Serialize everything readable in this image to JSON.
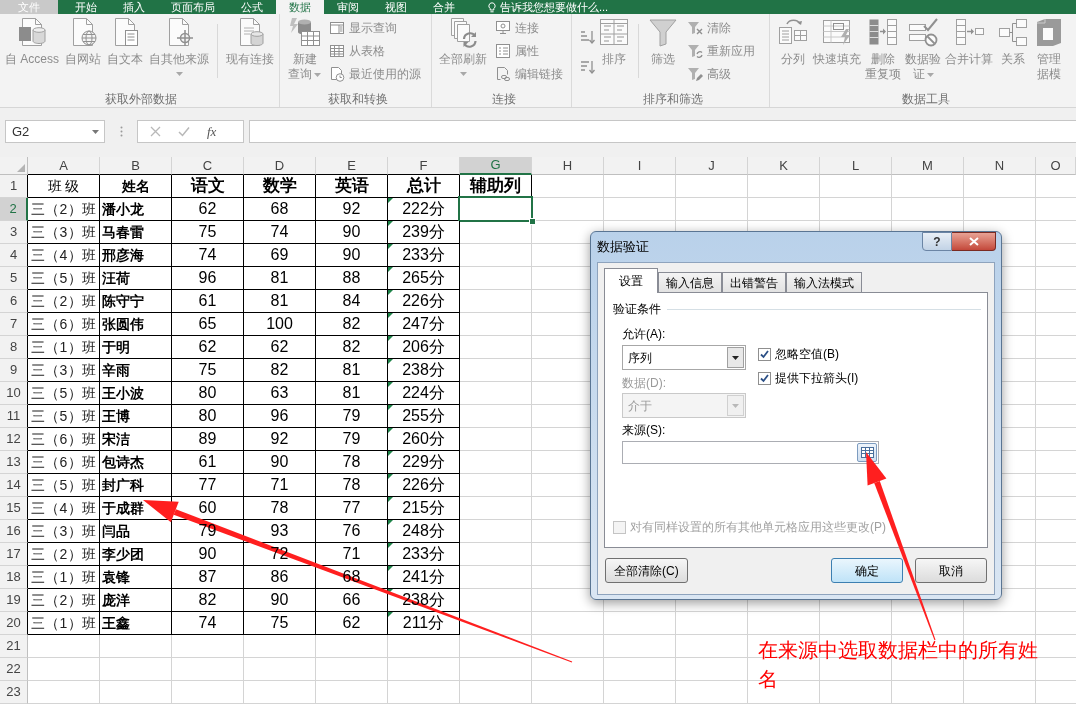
{
  "ribbon": {
    "tabs": [
      {
        "label": "文件",
        "kind": "file",
        "selected": false
      },
      {
        "label": "开始",
        "kind": "tab",
        "selected": false
      },
      {
        "label": "插入",
        "kind": "tab",
        "selected": false
      },
      {
        "label": "页面布局",
        "kind": "tab",
        "selected": false
      },
      {
        "label": "公式",
        "kind": "tab",
        "selected": false
      },
      {
        "label": "数据",
        "kind": "tab",
        "selected": true
      },
      {
        "label": "审阅",
        "kind": "tab",
        "selected": false
      },
      {
        "label": "视图",
        "kind": "tab",
        "selected": false
      },
      {
        "label": "合并",
        "kind": "tab",
        "selected": false
      }
    ],
    "tell_me": {
      "placeholder": "告诉我您想要做什么..."
    },
    "groups": [
      {
        "label": "获取外部数据",
        "items": [
          {
            "kind": "large",
            "lines": [
              "自 Access"
            ],
            "dropdown": false
          },
          {
            "kind": "large",
            "lines": [
              "自网站"
            ],
            "dropdown": false
          },
          {
            "kind": "large",
            "lines": [
              "自文本"
            ],
            "dropdown": false
          },
          {
            "kind": "large",
            "lines": [
              "自其他来源"
            ],
            "dropdown": true
          },
          {
            "kind": "separator"
          },
          {
            "kind": "large",
            "lines": [
              "现有连接"
            ],
            "dropdown": false
          }
        ]
      },
      {
        "label": "获取和转换",
        "items": [
          {
            "kind": "large",
            "lines": [
              "新建",
              "查询"
            ],
            "dropdown": true
          },
          {
            "kind": "small",
            "label": "显示查询"
          },
          {
            "kind": "small",
            "label": "从表格"
          },
          {
            "kind": "small",
            "label": "最近使用的源"
          }
        ]
      },
      {
        "label": "连接",
        "items": [
          {
            "kind": "large",
            "lines": [
              "全部刷新"
            ],
            "dropdown": true
          },
          {
            "kind": "small",
            "label": "连接"
          },
          {
            "kind": "small",
            "label": "属性"
          },
          {
            "kind": "small",
            "label": "编辑链接"
          }
        ]
      },
      {
        "label": "排序和筛选",
        "items": [
          {
            "kind": "icon"
          },
          {
            "kind": "icon"
          },
          {
            "kind": "large",
            "lines": [
              "排序"
            ],
            "dropdown": false
          },
          {
            "kind": "separator"
          },
          {
            "kind": "large",
            "lines": [
              "筛选"
            ],
            "dropdown": false
          },
          {
            "kind": "small",
            "label": "清除"
          },
          {
            "kind": "small",
            "label": "重新应用"
          },
          {
            "kind": "small",
            "label": "高级"
          }
        ]
      },
      {
        "label": "数据工具",
        "items": [
          {
            "kind": "large",
            "lines": [
              "分列"
            ],
            "dropdown": false
          },
          {
            "kind": "large",
            "lines": [
              "快速填充"
            ],
            "dropdown": false
          },
          {
            "kind": "large",
            "lines": [
              "删除",
              "重复项"
            ],
            "dropdown": false
          },
          {
            "kind": "large",
            "lines": [
              "数据验",
              "证"
            ],
            "dropdown": true
          },
          {
            "kind": "large",
            "lines": [
              "合并计算"
            ],
            "dropdown": false
          },
          {
            "kind": "large",
            "lines": [
              "关系"
            ],
            "dropdown": false
          },
          {
            "kind": "large",
            "lines": [
              "管理",
              "据模"
            ],
            "dropdown": false
          }
        ]
      }
    ]
  },
  "formula_bar": {
    "name_box": "G2",
    "function_label": "fx"
  },
  "sheet": {
    "columns": [
      {
        "label": "A",
        "selected": false
      },
      {
        "label": "B",
        "selected": false
      },
      {
        "label": "C",
        "selected": false
      },
      {
        "label": "D",
        "selected": false
      },
      {
        "label": "E",
        "selected": false
      },
      {
        "label": "F",
        "selected": false
      },
      {
        "label": "G",
        "selected": true
      },
      {
        "label": "H",
        "selected": false
      },
      {
        "label": "I",
        "selected": false
      },
      {
        "label": "J",
        "selected": false
      },
      {
        "label": "K",
        "selected": false
      },
      {
        "label": "L",
        "selected": false
      },
      {
        "label": "M",
        "selected": false
      },
      {
        "label": "N",
        "selected": false
      },
      {
        "label": "O",
        "selected": false
      }
    ],
    "rows": [
      {
        "label": "1",
        "selected": false
      },
      {
        "label": "2",
        "selected": true
      },
      {
        "label": "3",
        "selected": false
      },
      {
        "label": "4",
        "selected": false
      },
      {
        "label": "5",
        "selected": false
      },
      {
        "label": "6",
        "selected": false
      },
      {
        "label": "7",
        "selected": false
      },
      {
        "label": "8",
        "selected": false
      },
      {
        "label": "9",
        "selected": false
      },
      {
        "label": "10",
        "selected": false
      },
      {
        "label": "11",
        "selected": false
      },
      {
        "label": "12",
        "selected": false
      },
      {
        "label": "13",
        "selected": false
      },
      {
        "label": "14",
        "selected": false
      },
      {
        "label": "15",
        "selected": false
      },
      {
        "label": "16",
        "selected": false
      },
      {
        "label": "17",
        "selected": false
      },
      {
        "label": "18",
        "selected": false
      },
      {
        "label": "19",
        "selected": false
      },
      {
        "label": "20",
        "selected": false
      },
      {
        "label": "21",
        "selected": false
      },
      {
        "label": "22",
        "selected": false
      },
      {
        "label": "23",
        "selected": false
      }
    ],
    "table": {
      "header": [
        "班 级",
        "姓名",
        "语文",
        "数学",
        "英语",
        "总计",
        "辅助列"
      ],
      "rows": [
        {
          "cells": [
            "三（2）班",
            "潘小龙",
            "62",
            "68",
            "92",
            "222分"
          ],
          "warning": true
        },
        {
          "cells": [
            "三（3）班",
            "马春雷",
            "75",
            "74",
            "90",
            "239分"
          ],
          "warning": true
        },
        {
          "cells": [
            "三（4）班",
            "邢彦海",
            "74",
            "69",
            "90",
            "233分"
          ],
          "warning": true
        },
        {
          "cells": [
            "三（5）班",
            "汪荷",
            "96",
            "81",
            "88",
            "265分"
          ],
          "warning": true
        },
        {
          "cells": [
            "三（2）班",
            "陈守宁",
            "61",
            "81",
            "84",
            "226分"
          ],
          "warning": true
        },
        {
          "cells": [
            "三（6）班",
            "张圆伟",
            "65",
            "100",
            "82",
            "247分"
          ],
          "warning": true
        },
        {
          "cells": [
            "三（1）班",
            "于明",
            "62",
            "62",
            "82",
            "206分"
          ],
          "warning": true
        },
        {
          "cells": [
            "三（3）班",
            "辛雨",
            "75",
            "82",
            "81",
            "238分"
          ],
          "warning": true
        },
        {
          "cells": [
            "三（5）班",
            "王小波",
            "80",
            "63",
            "81",
            "224分"
          ],
          "warning": true
        },
        {
          "cells": [
            "三（5）班",
            "王博",
            "80",
            "96",
            "79",
            "255分"
          ],
          "warning": true
        },
        {
          "cells": [
            "三（6）班",
            "宋洁",
            "89",
            "92",
            "79",
            "260分"
          ],
          "warning": true
        },
        {
          "cells": [
            "三（6）班",
            "包诗杰",
            "61",
            "90",
            "78",
            "229分"
          ],
          "warning": true
        },
        {
          "cells": [
            "三（5）班",
            "封广科",
            "77",
            "71",
            "78",
            "226分"
          ],
          "warning": true
        },
        {
          "cells": [
            "三（4）班",
            "于成群",
            "60",
            "78",
            "77",
            "215分"
          ],
          "warning": true
        },
        {
          "cells": [
            "三（3）班",
            "闫品",
            "79",
            "93",
            "76",
            "248分"
          ],
          "warning": true
        },
        {
          "cells": [
            "三（2）班",
            "李少团",
            "90",
            "72",
            "71",
            "233分"
          ],
          "warning": true
        },
        {
          "cells": [
            "三（1）班",
            "袁锋",
            "87",
            "86",
            "68",
            "241分"
          ],
          "warning": true
        },
        {
          "cells": [
            "三（2）班",
            "庞洋",
            "82",
            "90",
            "66",
            "238分"
          ],
          "warning": true
        },
        {
          "cells": [
            "三（1）班",
            "王鑫",
            "74",
            "75",
            "62",
            "211分"
          ],
          "warning": true
        }
      ]
    }
  },
  "dialog": {
    "title": "数据验证",
    "help_label": "?",
    "tabs": [
      {
        "label": "设置",
        "selected": true
      },
      {
        "label": "输入信息",
        "selected": false
      },
      {
        "label": "出错警告",
        "selected": false
      },
      {
        "label": "输入法模式",
        "selected": false
      }
    ],
    "section": "验证条件",
    "allow": {
      "label": "允许(A):",
      "value": "序列",
      "disabled": false
    },
    "data": {
      "label": "数据(D):",
      "value": "介于",
      "disabled": true
    },
    "checkboxes": [
      {
        "label": "忽略空值(B)",
        "checked": true,
        "disabled": false
      },
      {
        "label": "提供下拉箭头(I)",
        "checked": true,
        "disabled": false
      }
    ],
    "source": {
      "label": "来源(S):"
    },
    "apply_all": {
      "label": "对有同样设置的所有其他单元格应用这些更改(P)",
      "checked": false,
      "disabled": true
    },
    "buttons": [
      {
        "label": "全部清除(C)",
        "kind": "normal"
      },
      {
        "label": "确定",
        "kind": "default"
      },
      {
        "label": "取消",
        "kind": "normal"
      }
    ]
  },
  "annotation": {
    "text": "在来源中选取数据栏中的所有姓名"
  }
}
